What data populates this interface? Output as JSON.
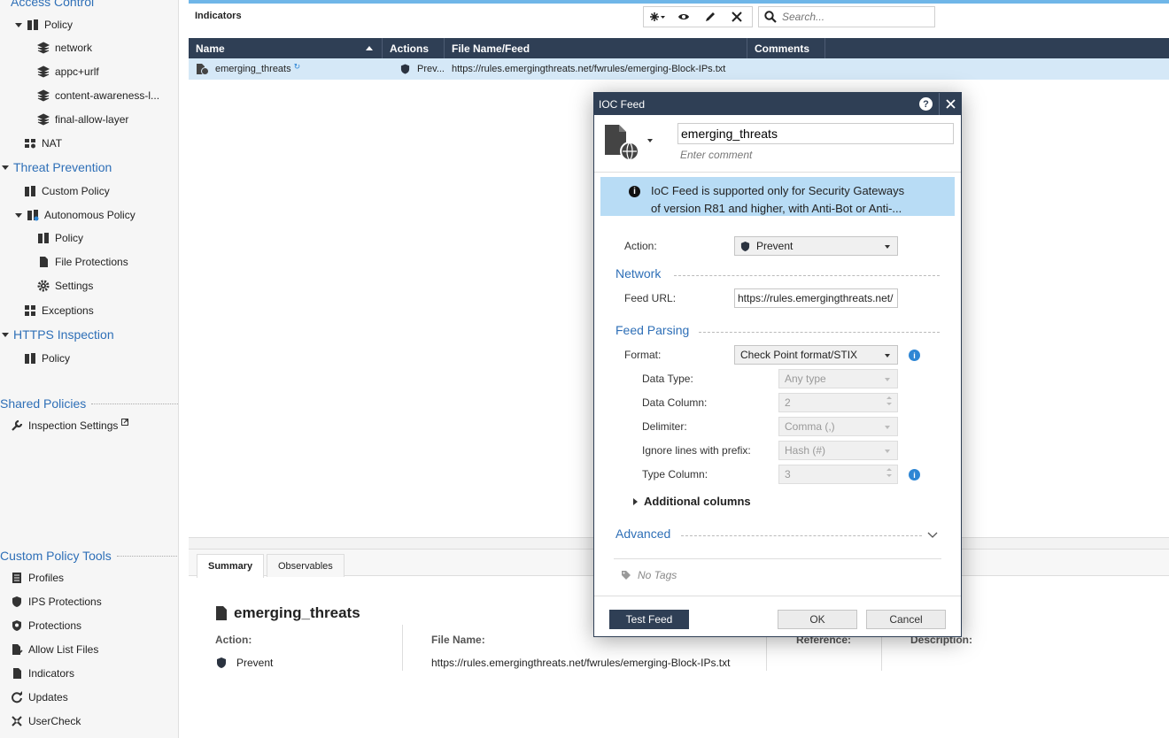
{
  "nav": {
    "access_control": "Access Control",
    "policy": "Policy",
    "network": "network",
    "appc_urlf": "appc+urlf",
    "content_awareness": "content-awareness-l...",
    "final_allow": "final-allow-layer",
    "nat": "NAT",
    "threat_prevention": "Threat Prevention",
    "custom_policy": "Custom Policy",
    "autonomous_policy": "Autonomous Policy",
    "auto_policy": "Policy",
    "file_protections": "File Protections",
    "settings": "Settings",
    "exceptions": "Exceptions",
    "https_inspection": "HTTPS Inspection",
    "https_policy": "Policy",
    "shared_policies": "Shared Policies",
    "inspection_settings": "Inspection Settings",
    "custom_policy_tools": "Custom Policy Tools",
    "profiles": "Profiles",
    "ips_protections": "IPS Protections",
    "protections": "Protections",
    "allow_list_files": "Allow List Files",
    "indicators": "Indicators",
    "updates": "Updates",
    "usercheck": "UserCheck"
  },
  "main": {
    "title": "Indicators",
    "search_placeholder": "Search..."
  },
  "grid": {
    "headers": {
      "name": "Name",
      "actions": "Actions",
      "file": "File Name/Feed",
      "comments": "Comments"
    },
    "row": {
      "name": "emerging_threats",
      "action": "Prev...",
      "file": "https://rules.emergingthreats.net/fwrules/emerging-Block-IPs.txt",
      "comments": ""
    }
  },
  "tabs": {
    "summary": "Summary",
    "observables": "Observables"
  },
  "summary": {
    "title": "emerging_threats",
    "action_label": "Action:",
    "action_value": "Prevent",
    "file_label": "File Name:",
    "file_value": "https://rules.emergingthreats.net/fwrules/emerging-Block-IPs.txt",
    "reference_label": "Reference:",
    "description_label": "Description:"
  },
  "dialog": {
    "title": "IOC Feed",
    "help": "?",
    "name_value": "emerging_threats",
    "comment_placeholder": "Enter comment",
    "info_line1": "IoC Feed is supported only for Security Gateways",
    "info_line2": "of version R81 and higher, with Anti-Bot or Anti-...",
    "action_label": "Action:",
    "action_value": "Prevent",
    "network_section": "Network",
    "feed_url_label": "Feed URL:",
    "feed_url_value": "https://rules.emergingthreats.net/",
    "feed_parsing_section": "Feed Parsing",
    "format_label": "Format:",
    "format_value": "Check Point format/STIX",
    "data_type_label": "Data Type:",
    "data_type_value": "Any type",
    "data_column_label": "Data Column:",
    "data_column_value": "2",
    "delimiter_label": "Delimiter:",
    "delimiter_value": "Comma (,)",
    "ignore_label": "Ignore lines with prefix:",
    "ignore_value": "Hash (#)",
    "type_column_label": "Type Column:",
    "type_column_value": "3",
    "additional_columns": "Additional columns",
    "advanced_section": "Advanced",
    "no_tags": "No Tags",
    "test_feed": "Test Feed",
    "ok": "OK",
    "cancel": "Cancel"
  },
  "colors": {
    "nav_link": "#2e6fb7",
    "header_dark": "#2f3f55",
    "selected_row": "#d5e8f7",
    "info_banner": "#b8dcf5"
  }
}
